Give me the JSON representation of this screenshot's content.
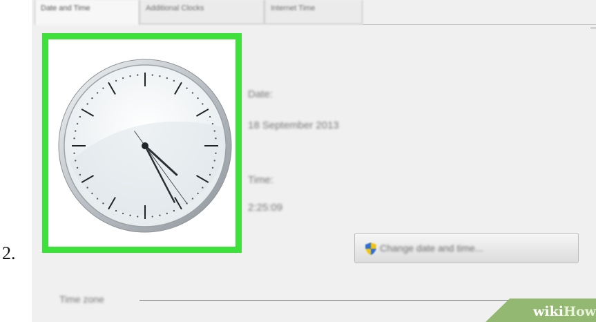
{
  "step": {
    "number": "2."
  },
  "tabs": [
    {
      "label": "Date and Time",
      "active": true
    },
    {
      "label": "Additional Clocks",
      "active": false
    },
    {
      "label": "Internet Time",
      "active": false
    }
  ],
  "date": {
    "label": "Date:",
    "value": "18 September 2013"
  },
  "time": {
    "label": "Time:",
    "value": "2:25:09"
  },
  "clock": {
    "hour": 4,
    "minute": 25,
    "second": 24
  },
  "buttons": {
    "change_date_time": "Change date and time..."
  },
  "timezone": {
    "label": "Time zone"
  },
  "watermark": {
    "prefix": "wiki",
    "suffix": "How"
  },
  "colors": {
    "highlight": "#3ee03b",
    "watermark": "#93b872",
    "window": "#f0f0f0"
  },
  "icons": {
    "change_button_icon": "uac-shield-icon"
  }
}
